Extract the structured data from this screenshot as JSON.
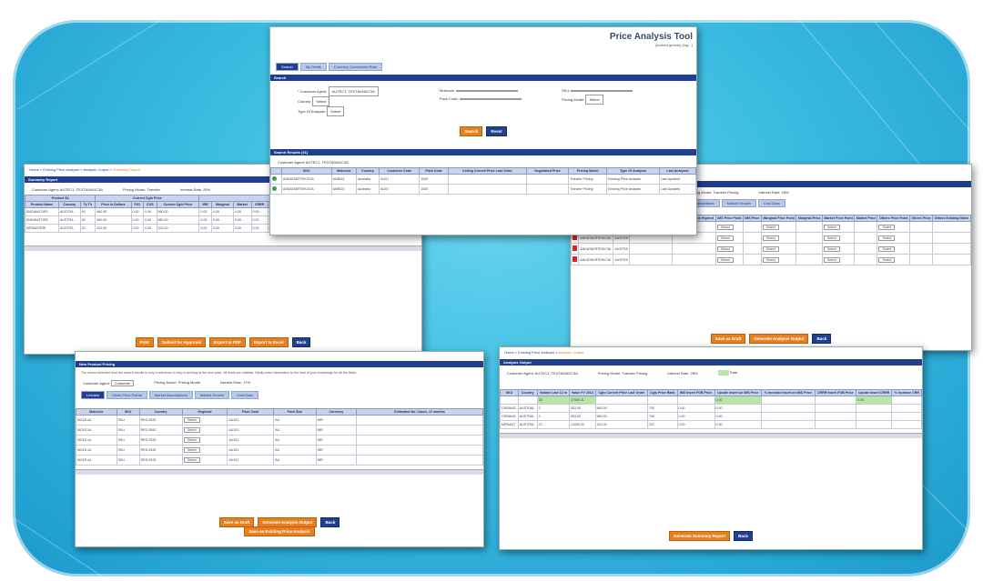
{
  "colors": {
    "backdrop": "#3bbce1",
    "nav_bar": "#1f3b8c",
    "button_orange": "#e8801f",
    "button_blue": "#233f8f"
  },
  "search": {
    "title": "Price Analysis Tool",
    "user_line": "(docked greeds) (log...)",
    "tabs": [
      "Search",
      "My Drafts",
      "Currency Conversion Rate"
    ],
    "section": "Search",
    "fields": [
      {
        "label": "* Customer Agent:",
        "value": "AUTEC1, TEXTA0461C3A"
      },
      {
        "label": "Country:",
        "value": "Select"
      },
      {
        "label": "Type Of Analysis:",
        "value": "Select"
      },
      {
        "label": "Molecule:",
        "value": ""
      },
      {
        "label": "Pack Code:",
        "value": ""
      },
      {
        "label": "SKU:",
        "value": ""
      },
      {
        "label": "Pricing Model:",
        "value": "Select"
      }
    ],
    "buttons": [
      "Search",
      "Reset"
    ],
    "results_title": "Search Results (31)",
    "results_agent": "Customer Agent: AUTEC1, TEXTA0461C3A",
    "columns": [
      "",
      "SKU",
      "Molecule",
      "Country",
      "Customer Code",
      "Pack Code",
      "Ceiling Current Price Last Order",
      "Negotiated Price",
      "Pricing Model",
      "Type Of Analysis",
      "Last Analyzed"
    ],
    "rows": [
      [
        "",
        "ANDATAERTEKIC3A",
        "AN8021",
        "Australia",
        "AU01",
        "1000",
        "",
        "",
        "Transfer Pricing",
        "Existing Price Analysis",
        "Last Updated"
      ],
      [
        "",
        "ANDATAERTEKIC3A",
        "AN8021",
        "Australia",
        "AU01",
        "1000",
        "",
        "",
        "Transfer Pricing",
        "Existing Price Analysis",
        "Last Updated"
      ]
    ]
  },
  "summary": {
    "breadcrumb": [
      "Home",
      "Existing Price Analysis",
      "Analysis Output",
      "Summary Report"
    ],
    "title": "Summary Report",
    "customer": "Customer Agent: AUTEC1, TEXTA0461C3A",
    "pricing_model": "Pricing Model: Transfer",
    "interest": "Interest Rate: 28%",
    "groups": [
      "Product Sk",
      "Current Cglo Price",
      "FOB Price"
    ],
    "columns": [
      "Product Name",
      "Country",
      "Ty Th",
      "Price In Dollars",
      "FX1",
      "COS",
      "Current Cglo Price",
      "IRR",
      "Marginal",
      "Market",
      "CRRR",
      "Other",
      "Market Price",
      "Negotiated Price",
      "Market Pricing",
      "Exchange Rate"
    ],
    "rows": [
      [
        "ENDANGTIER",
        "AUSTRA",
        "40",
        "560.00",
        "0.00",
        "0.00",
        "560.00",
        "0.00",
        "0.00",
        "0.00",
        "0.00",
        "0.00",
        "0.00",
        "0.00",
        "2000.00",
        "1.00"
      ],
      [
        "ENDANGTIER",
        "AUSTRA",
        "40",
        "560.00",
        "0.00",
        "0.00",
        "560.00",
        "0.00",
        "0.00",
        "0.00",
        "0.00",
        "0.00",
        "0.00",
        "0.00",
        "1000.00",
        "1.00"
      ],
      [
        "MRSANTERI",
        "AUSTRA",
        "22",
        "322.00",
        "0.00",
        "0.00",
        "322.00",
        "0.00",
        "0.00",
        "0.00",
        "0.00",
        "0.00",
        "0.00",
        "0.00",
        "42380.0",
        "1.00"
      ]
    ],
    "buttons": [
      "Print",
      "Submit for Approval",
      "Export to PDF",
      "Export to Excel",
      "Back"
    ]
  },
  "pricing": {
    "header": "Pricing Model: Transfer Pricing",
    "interest": "Interest Rate: 28%",
    "tabs": [
      "Competitors",
      "Market Growth",
      "Cost Data"
    ],
    "columns": [
      "",
      "SKU",
      "Country",
      "COGS FOB Price Lowest",
      "COGS FOB Price Highest",
      "IMS Price Point",
      "IMS Price",
      "Marginal Price Point",
      "Marginal Price",
      "Market Price Point",
      "Market Price",
      "Others Price Point",
      "Others Price",
      "Others Existing Notes"
    ],
    "rows": [
      [
        "",
        "ANDATAERTEKIC3A",
        "AUSTRA",
        "",
        "",
        "Select",
        "",
        "Select",
        "",
        "Select",
        "",
        "Select",
        "",
        ""
      ],
      [
        "",
        "ANDATAERTEKIC3A",
        "AUSTRA",
        "",
        "",
        "Select",
        "",
        "Select",
        "",
        "Select",
        "",
        "Select",
        "",
        ""
      ],
      [
        "",
        "ANDATAERTEKIC3A",
        "AUSTRA",
        "",
        "",
        "Select",
        "",
        "Select",
        "",
        "Select",
        "",
        "Select",
        "",
        ""
      ],
      [
        "",
        "ANDATAERTEKIC3A",
        "AUSTRA",
        "",
        "",
        "Select",
        "",
        "Select",
        "",
        "Select",
        "",
        "Select",
        "",
        ""
      ]
    ],
    "buttons": [
      "Save as Draft",
      "Generate Analysis Output",
      "Back"
    ]
  },
  "newprod": {
    "breadcrumb": [
      "New Product Pricing"
    ],
    "title": "New Product Pricing",
    "note": "The record selected from the search results is only a reference to help in arriving at the new price. All fields are editable. Kindly enter information to the best of your knowledge for all the fields.",
    "customer_label": "Customer Agent:",
    "customer_value": "Customer",
    "pricing": "Pricing Model: Pricing Model",
    "interest": "Interest Rate: 17%",
    "tabs": [
      "Lineaire",
      "Other Price Points",
      "Market Assumptions",
      "Market Growth",
      "Cost Data"
    ],
    "columns": [
      "Molecule",
      "SKU",
      "Country",
      "Regional",
      "Pack Code",
      "Pack Size",
      "Currency",
      "Estimated No. Cases, 12 months"
    ],
    "rows": [
      [
        "MOLE-AL",
        "SKU",
        "REG-ENG",
        "Select",
        "AU101",
        "AU",
        "INR",
        ""
      ],
      [
        "MOLE-AL",
        "SKU",
        "REG-ENG",
        "Select",
        "AU101",
        "AU",
        "INR",
        ""
      ],
      [
        "MOLE-AL",
        "SKU",
        "REG-ENG",
        "Select",
        "AU101",
        "AU",
        "INR",
        ""
      ],
      [
        "MOLE-AL",
        "SKU",
        "REG-ENG",
        "Select",
        "AU101",
        "AU",
        "INR",
        ""
      ],
      [
        "MOLE-AL",
        "SKU",
        "REG-ENG",
        "Select",
        "AU101",
        "AU",
        "INR",
        ""
      ]
    ],
    "buttons": [
      "Save as Draft",
      "Generate Analysis Output",
      "Back"
    ],
    "button2": "Save as Existing Price Analysis"
  },
  "analysis": {
    "breadcrumb": [
      "Home",
      "Existing Price Analysis",
      "Analysis Output"
    ],
    "title": "Analysis Output",
    "customer": "Customer Agent: AUTEC1, TEXTA0461C3A",
    "pricing": "Pricing Model: Transfer Pricing",
    "interest": "Interest Rate: 28%",
    "legend": "Total",
    "columns": [
      "SKU",
      "Country",
      "Volume Last 12 m",
      "Value FY 2013",
      "Cglo Current Price Last Order",
      "Cglo Price Rank",
      "IMS Insert FOB Price",
      "Upside Insert on IMS Price",
      "% Increase Insert on IMS Price",
      "CRRR Insert FOB Price",
      "Upside Insert CRRR",
      "% Increase CRR"
    ],
    "totals": [
      "",
      "",
      "26",
      "27500.11",
      "",
      "",
      "",
      "0.00",
      "",
      "",
      "0.00",
      ""
    ],
    "rows": [
      [
        "CRRANG",
        "AUSTRAL",
        "2",
        "553.00",
        "560.00",
        "700",
        "0.00",
        "0.00",
        "",
        "",
        "",
        ""
      ],
      [
        "CRRANG",
        "AUSTRAL",
        "2",
        "553.00",
        "560.00",
        "700",
        "0.00",
        "0.00",
        "",
        "",
        "",
        ""
      ],
      [
        "MRSANT",
        "AUSTRAL",
        "22",
        "12000.00",
        "322.00",
        "237",
        "0.00",
        "0.00",
        "",
        "",
        "",
        ""
      ]
    ],
    "buttons": [
      "Generate Summary Report",
      "Back"
    ]
  }
}
